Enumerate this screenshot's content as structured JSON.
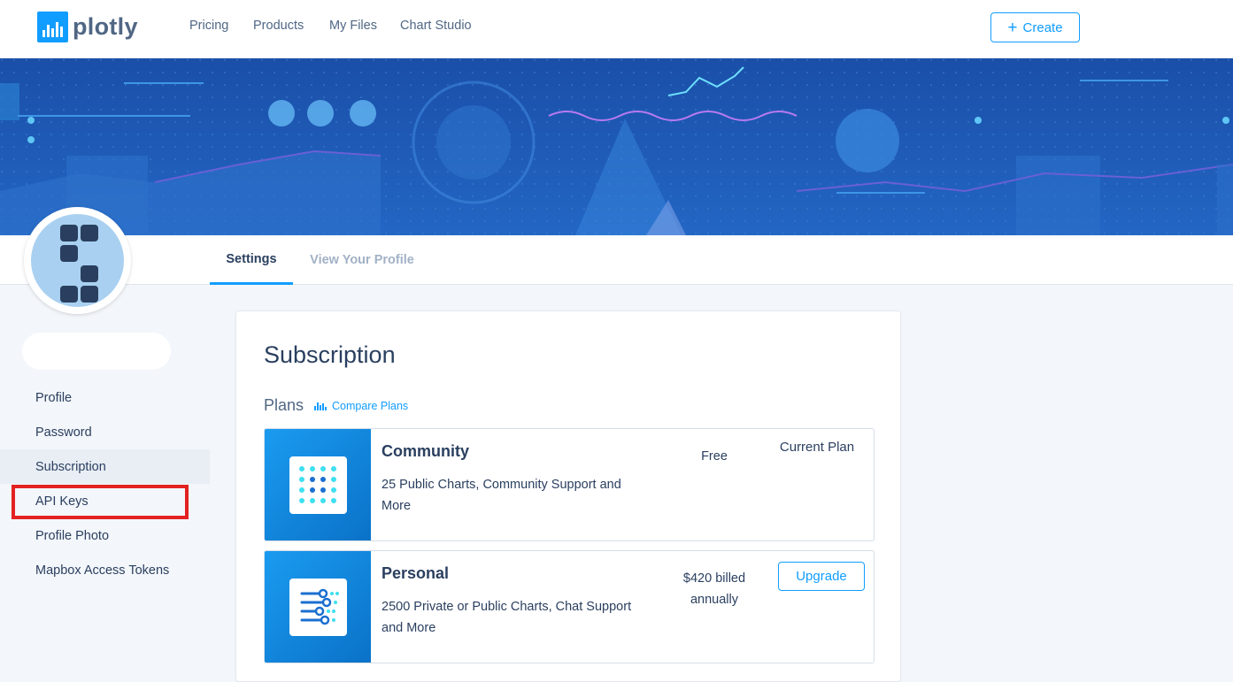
{
  "header": {
    "logo_text": "plotly",
    "nav": [
      "Pricing",
      "Products",
      "My Files",
      "Chart Studio"
    ],
    "create_label": "Create"
  },
  "tabs": {
    "settings": "Settings",
    "view_profile": "View Your Profile"
  },
  "sidebar": {
    "items": [
      {
        "label": "Profile"
      },
      {
        "label": "Password"
      },
      {
        "label": "Subscription"
      },
      {
        "label": "API Keys"
      },
      {
        "label": "Profile Photo"
      },
      {
        "label": "Mapbox Access Tokens"
      }
    ],
    "selected": "Subscription",
    "highlighted": "API Keys"
  },
  "main": {
    "title": "Subscription",
    "plans_label": "Plans",
    "compare_link": "Compare Plans",
    "plans": [
      {
        "name": "Community",
        "description": "25 Public Charts, Community Support and More",
        "price": "Free",
        "status": "Current Plan"
      },
      {
        "name": "Personal",
        "description": "2500 Private or Public Charts, Chat Support and More",
        "price": "$420 billed annually",
        "action": "Upgrade"
      }
    ]
  },
  "colors": {
    "accent": "#119dff",
    "text": "#2a3f5f",
    "banner": "#1c56b3",
    "highlight_box": "#e32121"
  }
}
